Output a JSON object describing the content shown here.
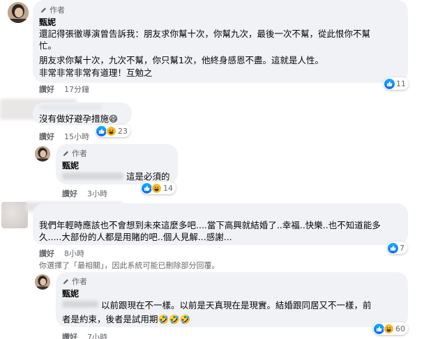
{
  "comments": [
    {
      "author_tag": "作者",
      "name": "甄妮",
      "lines": [
        "還記得張徹導演曾告訴我：朋友求你幫十次，你幫九次，最後一次不幫，從此恨你不幫",
        "忙。",
        "朋友求你幫十次，九次不幫，你只幫1次，他終身感恩不盡。這就是人性。",
        "非常非常非常有道理！互勉之"
      ],
      "like_label": "讚好",
      "time": "17分鐘",
      "reaction_count": "11"
    },
    {
      "text": "沒有做好避孕措施😄",
      "like_label": "讚好",
      "time": "15小時",
      "reaction_count": "23"
    },
    {
      "author_tag": "作者",
      "name": "甄妮",
      "text": "這是必須的",
      "like_label": "讚好",
      "time": "3小時",
      "reaction_count": "14"
    },
    {
      "lines": [
        "我們年輕時應該也不會想到未來這麼多吧....當下高興就結婚了..幸福..快樂..也不知道能多",
        "久.....大部份的人都是用賭的吧..個人見解...感謝..."
      ],
      "like_label": "讚好",
      "time": "8小時",
      "reaction_count": "7"
    },
    {
      "author_tag": "作者",
      "name": "甄妮",
      "lines": [
        "以前跟現在不一樣。以前是天真現在是現實。結婚跟同居又不一樣，前",
        "者是約束，後者是試用期🤣🤣🤣"
      ],
      "like_label": "讚好",
      "time": "7小時",
      "reaction_count": "60"
    }
  ],
  "filter_note": "你選擇了「最相關」，因此系統可能已刪除部分回覆。",
  "colors": {
    "bubble_bg": "#f0f2f5",
    "meta_text": "#65676b",
    "like_blue": "#0866ff",
    "haha_yellow": "#f7b928"
  },
  "icons": [
    "pencil-icon",
    "like-reaction-icon",
    "haha-reaction-icon"
  ]
}
